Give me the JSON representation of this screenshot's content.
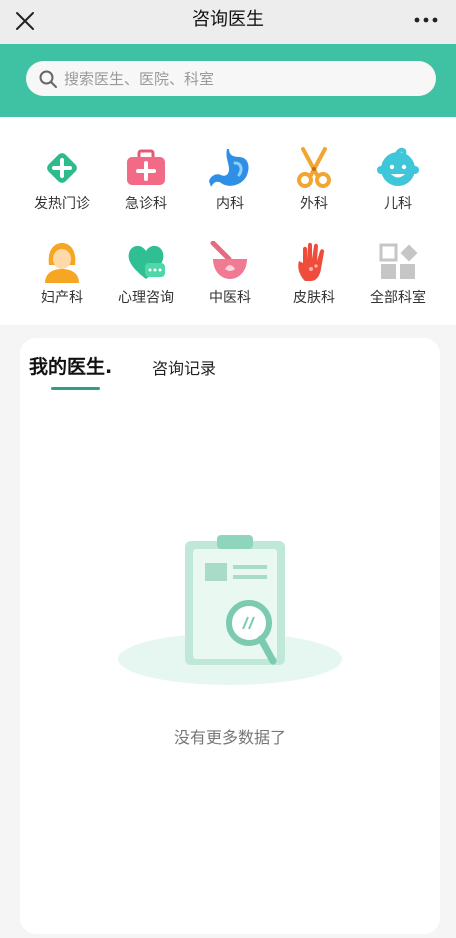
{
  "navbar": {
    "title": "咨询医生",
    "close_icon": "close-icon",
    "more_icon": "more-icon"
  },
  "search": {
    "placeholder": "搜索医生、医院、科室",
    "icon": "search-icon"
  },
  "departments": [
    {
      "label": "发热门诊",
      "icon": "fever-clinic-icon"
    },
    {
      "label": "急诊科",
      "icon": "emergency-kit-icon"
    },
    {
      "label": "内科",
      "icon": "stomach-icon"
    },
    {
      "label": "外科",
      "icon": "scissors-icon"
    },
    {
      "label": "儿科",
      "icon": "child-face-icon"
    },
    {
      "label": "妇产科",
      "icon": "woman-icon"
    },
    {
      "label": "心理咨询",
      "icon": "heart-chat-icon"
    },
    {
      "label": "中医科",
      "icon": "mortar-pestle-icon"
    },
    {
      "label": "皮肤科",
      "icon": "hand-icon"
    },
    {
      "label": "全部科室",
      "icon": "all-departments-icon"
    }
  ],
  "tabs": {
    "mine": "我的医生.",
    "records": "咨询记录"
  },
  "empty": {
    "message": "没有更多数据了",
    "icon": "clipboard-magnifier-icon"
  },
  "colors": {
    "accent": "#3fc2a4",
    "tab_underline": "#2f9e87",
    "navbar_bg": "#ededed"
  }
}
